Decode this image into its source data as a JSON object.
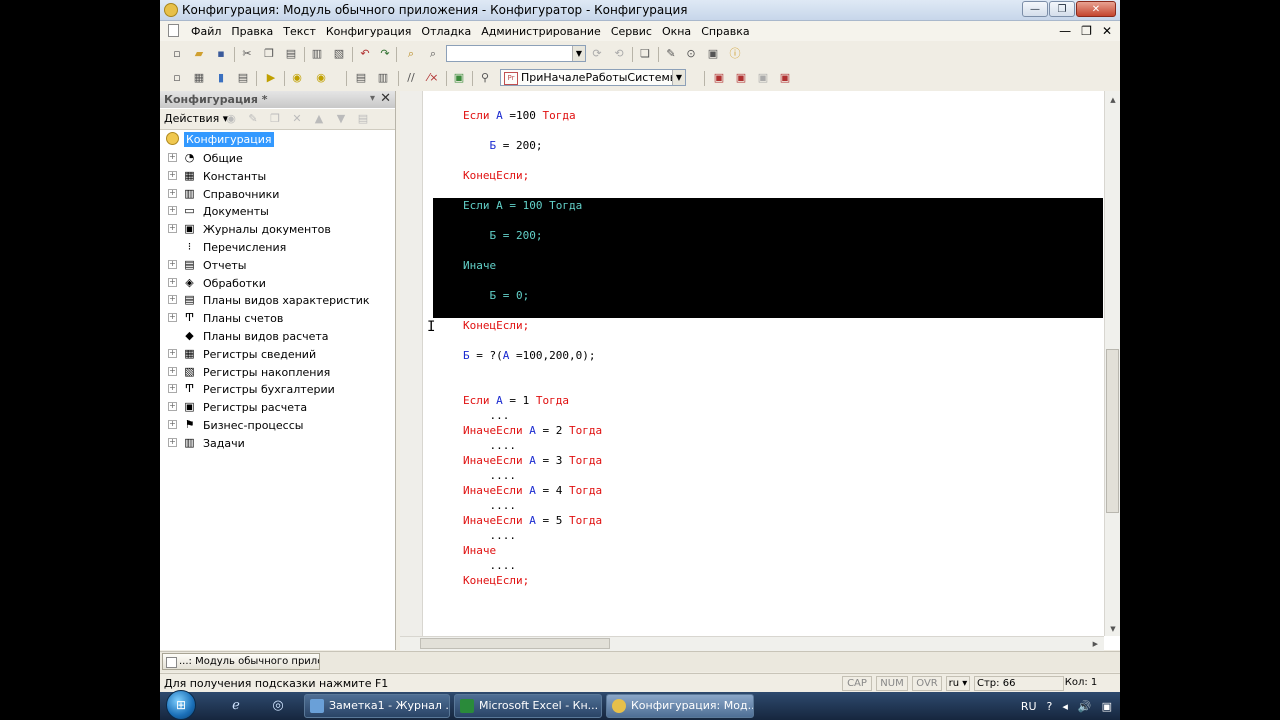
{
  "window": {
    "title": "Конфигурация: Модуль обычного приложения - Конфигуратор - Конфигурация",
    "minimize": "—",
    "maximize": "❐",
    "close": "✕"
  },
  "menu": {
    "items": [
      "Файл",
      "Правка",
      "Текст",
      "Конфигурация",
      "Отладка",
      "Администрирование",
      "Сервис",
      "Окна",
      "Справка"
    ],
    "mdi_min": "—",
    "mdi_restore": "❐",
    "mdi_close": "✕"
  },
  "toolbar": {
    "search_value": "",
    "procedure_combo": "ПриНачалеРаботыСистемы",
    "combo_arrow": "▼"
  },
  "panel": {
    "title": "Конфигурация *",
    "pin": "▾",
    "close": "✕",
    "actions_label": "Действия ▾",
    "tree": [
      {
        "label": "Конфигурация",
        "icon": "config-root-icon",
        "glyph": ""
      },
      {
        "label": "Общие",
        "icon": "common-icon",
        "glyph": "◔"
      },
      {
        "label": "Константы",
        "icon": "constants-icon",
        "glyph": "▦"
      },
      {
        "label": "Справочники",
        "icon": "catalogs-icon",
        "glyph": "▥"
      },
      {
        "label": "Документы",
        "icon": "documents-icon",
        "glyph": "▭"
      },
      {
        "label": "Журналы документов",
        "icon": "journals-icon",
        "glyph": "▣"
      },
      {
        "label": "Перечисления",
        "icon": "enums-icon",
        "glyph": "⁝"
      },
      {
        "label": "Отчеты",
        "icon": "reports-icon",
        "glyph": "▤"
      },
      {
        "label": "Обработки",
        "icon": "processing-icon",
        "glyph": "◈"
      },
      {
        "label": "Планы видов характеристик",
        "icon": "chart-char-icon",
        "glyph": "▤"
      },
      {
        "label": "Планы счетов",
        "icon": "chart-accounts-icon",
        "glyph": "Ͳ"
      },
      {
        "label": "Планы видов расчета",
        "icon": "chart-calc-icon",
        "glyph": "◆"
      },
      {
        "label": "Регистры сведений",
        "icon": "info-registers-icon",
        "glyph": "▦"
      },
      {
        "label": "Регистры накопления",
        "icon": "accum-registers-icon",
        "glyph": "▧"
      },
      {
        "label": "Регистры бухгалтерии",
        "icon": "acc-registers-icon",
        "glyph": "Ͳ"
      },
      {
        "label": "Регистры расчета",
        "icon": "calc-registers-icon",
        "glyph": "▣"
      },
      {
        "label": "Бизнес-процессы",
        "icon": "bp-icon",
        "glyph": "⚑"
      },
      {
        "label": "Задачи",
        "icon": "tasks-icon",
        "glyph": "▥"
      }
    ]
  },
  "code": {
    "lines": [
      [
        {
          "t": "Если ",
          "c": "kw"
        },
        {
          "t": "А",
          "c": "id"
        },
        {
          "t": " =100 "
        },
        {
          "t": "Тогда",
          "c": "kw"
        }
      ],
      [
        {
          "t": "    Б",
          "c": "id"
        },
        {
          "t": " = 200;"
        }
      ],
      [
        {
          "t": "КонецЕсли;",
          "c": "kw"
        }
      ],
      [
        {
          "t": "Если ",
          "c": "kw"
        },
        {
          "t": "А",
          "c": "id"
        },
        {
          "t": " = 100 "
        },
        {
          "t": "Тогда",
          "c": "kw"
        }
      ],
      [
        {
          "t": "    Б",
          "c": "id"
        },
        {
          "t": " = 200;"
        }
      ],
      [
        {
          "t": "Иначе",
          "c": "kw"
        }
      ],
      [
        {
          "t": "    Б",
          "c": "id"
        },
        {
          "t": " = 0;"
        }
      ],
      [
        {
          "t": "КонецЕсли;",
          "c": "kw"
        }
      ],
      [
        {
          "t": "Б",
          "c": "id"
        },
        {
          "t": " = ?("
        },
        {
          "t": "А",
          "c": "id"
        },
        {
          "t": " =100,200,0);"
        }
      ],
      [
        {
          "t": "Если ",
          "c": "kw"
        },
        {
          "t": "А",
          "c": "id"
        },
        {
          "t": " = 1 "
        },
        {
          "t": "Тогда",
          "c": "kw"
        }
      ],
      [
        {
          "t": "    ..."
        }
      ],
      [
        {
          "t": "ИначеЕсли ",
          "c": "kw"
        },
        {
          "t": "А",
          "c": "id"
        },
        {
          "t": " = 2 "
        },
        {
          "t": "Тогда",
          "c": "kw"
        }
      ],
      [
        {
          "t": "    ...."
        }
      ],
      [
        {
          "t": "ИначеЕсли ",
          "c": "kw"
        },
        {
          "t": "А",
          "c": "id"
        },
        {
          "t": " = 3 "
        },
        {
          "t": "Тогда",
          "c": "kw"
        }
      ],
      [
        {
          "t": "    ...."
        }
      ],
      [
        {
          "t": "ИначеЕсли ",
          "c": "kw"
        },
        {
          "t": "А",
          "c": "id"
        },
        {
          "t": " = 4 "
        },
        {
          "t": "Тогда",
          "c": "kw"
        }
      ],
      [
        {
          "t": "    ...."
        }
      ],
      [
        {
          "t": "ИначеЕсли ",
          "c": "kw"
        },
        {
          "t": "А",
          "c": "id"
        },
        {
          "t": " = 5 "
        },
        {
          "t": "Тогда",
          "c": "kw"
        }
      ],
      [
        {
          "t": "    ...."
        }
      ],
      [
        {
          "t": "Иначе",
          "c": "kw"
        }
      ],
      [
        {
          "t": "    ...."
        }
      ],
      [
        {
          "t": "КонецЕсли;",
          "c": "kw"
        }
      ]
    ],
    "selected_lines": [
      3,
      4,
      5,
      6
    ]
  },
  "tabs": {
    "window_tab": "...: Модуль обычного прило..."
  },
  "status": {
    "hint": "Для получения подсказки нажмите F1",
    "cap": "CAP",
    "num": "NUM",
    "ovr": "OVR",
    "lang": "ru ▾",
    "line": "Стр: 66",
    "col": "Кол: 1"
  },
  "taskbar": {
    "start": "⊞",
    "tasks": [
      "Заметка1 - Журнал ...",
      "Microsoft Excel - Кн...",
      "Конфигурация: Мод..."
    ],
    "lang": "RU",
    "icons": [
      "?",
      "◂",
      "🔊",
      "▣"
    ]
  }
}
